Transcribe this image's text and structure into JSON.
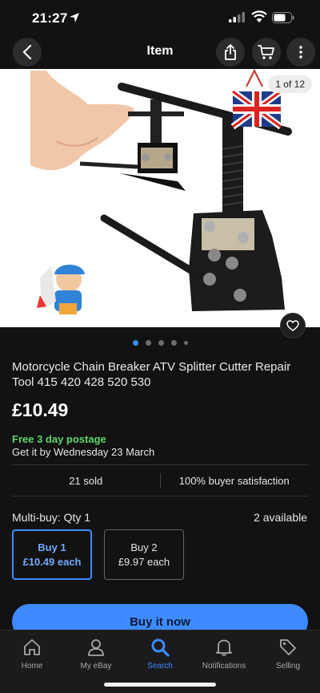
{
  "status": {
    "time": "21:27"
  },
  "nav": {
    "title": "Item"
  },
  "gallery": {
    "counter": "1 of 12",
    "total_images": 12,
    "current_image": 1
  },
  "listing": {
    "title": "Motorcycle Chain Breaker ATV Splitter Cutter Repair Tool 415 420 428 520 530",
    "price": "£10.49",
    "postage": "Free 3 day postage",
    "delivery": "Get it by Wednesday 23 March",
    "sold": "21 sold",
    "satisfaction": "100% buyer satisfaction"
  },
  "multibuy": {
    "label": "Multi-buy: Qty 1",
    "available": "2 available",
    "options": [
      {
        "line1": "Buy 1",
        "line2": "£10.49 each",
        "selected": true
      },
      {
        "line1": "Buy 2",
        "line2": "£9.97 each",
        "selected": false
      }
    ]
  },
  "cta": {
    "buy_now": "Buy it now"
  },
  "tabs": [
    {
      "label": "Home",
      "icon": "home-icon"
    },
    {
      "label": "My eBay",
      "icon": "person-icon"
    },
    {
      "label": "Search",
      "icon": "search-icon",
      "active": true
    },
    {
      "label": "Notifications",
      "icon": "bell-icon"
    },
    {
      "label": "Selling",
      "icon": "tag-icon"
    }
  ],
  "colors": {
    "accent": "#3d8bff",
    "postage_green": "#5ed46c",
    "background": "#121212"
  }
}
